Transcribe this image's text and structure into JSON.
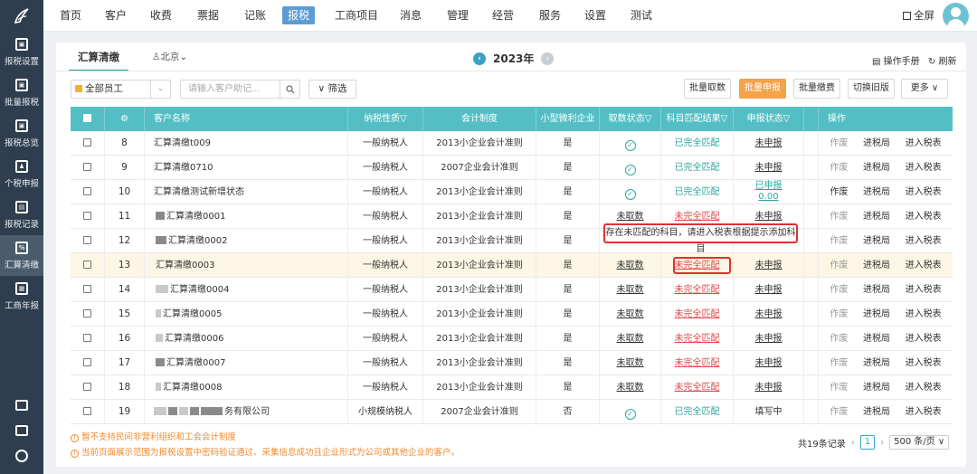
{
  "sidebar": {
    "items": [
      {
        "label": "报税设置",
        "icon": "monitor-gear-icon"
      },
      {
        "label": "批量报税",
        "icon": "monitor-upload-icon"
      },
      {
        "label": "报税总览",
        "icon": "monitor-chart-icon"
      },
      {
        "label": "个税申报",
        "icon": "person-tax-icon"
      },
      {
        "label": "报税记录",
        "icon": "record-icon"
      },
      {
        "label": "汇算清缴",
        "icon": "percent-doc-icon"
      },
      {
        "label": "工商年报",
        "icon": "annual-report-icon"
      }
    ],
    "bottom_icons": [
      "terminal-icon",
      "download-icon",
      "headset-icon"
    ]
  },
  "nav": {
    "items": [
      "首页",
      "客户",
      "收费",
      "票据",
      "记账",
      "报税",
      "工商项目",
      "消息",
      "管理",
      "经营",
      "服务",
      "设置",
      "测试"
    ],
    "active": "报税",
    "fullscreen": "全屏"
  },
  "page": {
    "tab": "汇算清缴",
    "location": "♙北京⌄",
    "year": "2023年",
    "manual": "操作手册",
    "refresh": "刷新"
  },
  "filters": {
    "employee": "全部员工",
    "search_placeholder": "请输入客户助记...",
    "filter_label": "筛选"
  },
  "actions": {
    "batch_fetch": "批量取数",
    "batch_declare": "批量申报",
    "batch_pay": "批量缴费",
    "switch_old": "切换旧版",
    "more": "更多"
  },
  "table": {
    "headers": [
      "客户名称",
      "纳税性质",
      "会计制度",
      "小型微利企业",
      "取数状态",
      "科目匹配结果",
      "申报状态",
      "操作"
    ],
    "rows": [
      {
        "no": "8",
        "name": "汇算清缴t009",
        "nature": "一般纳税人",
        "system": "2013小企业会计准则",
        "small": "是",
        "fetch": "✓",
        "match": "已完全匹配",
        "declare": "未申报",
        "op1": "作废",
        "op2": "进税局",
        "op3": "进入税表"
      },
      {
        "no": "9",
        "name": "汇算清缴0710",
        "nature": "一般纳税人",
        "system": "2007企业会计准则",
        "small": "是",
        "fetch": "✓",
        "match": "已完全匹配",
        "declare": "未申报",
        "op1": "作废",
        "op2": "进税局",
        "op3": "进入税表"
      },
      {
        "no": "10",
        "name": "汇算清缴测试新增状态",
        "nature": "一般纳税人",
        "system": "2013小企业会计准则",
        "small": "是",
        "fetch": "✓",
        "match": "已完全匹配",
        "declare": "已申报",
        "declare2": "0.00",
        "op1": "作废",
        "op2": "进税局",
        "op3": "进入税表"
      },
      {
        "no": "11",
        "name": "汇算清缴0001",
        "nature": "一般纳税人",
        "system": "2013小企业会计准则",
        "small": "是",
        "fetch": "未取数",
        "match": "未完全匹配",
        "declare": "未申报",
        "op1": "作废",
        "op2": "进税局",
        "op3": "进入税表"
      },
      {
        "no": "12",
        "name": "汇算清缴0002",
        "nature": "一般纳税人",
        "system": "2013小企业会计准则",
        "small": "是",
        "fetch": "",
        "match": "",
        "declare": "",
        "op1": "作废",
        "op2": "进税局",
        "op3": "进入税表"
      },
      {
        "no": "13",
        "name": "汇算清缴0003",
        "nature": "一般纳税人",
        "system": "2013小企业会计准则",
        "small": "是",
        "fetch": "未取数",
        "match": "未完全匹配",
        "declare": "未申报",
        "op1": "作废",
        "op2": "进税局",
        "op3": "进入税表"
      },
      {
        "no": "14",
        "name": "汇算清缴0004",
        "nature": "一般纳税人",
        "system": "2013小企业会计准则",
        "small": "是",
        "fetch": "未取数",
        "match": "未完全匹配",
        "declare": "未申报",
        "op1": "作废",
        "op2": "进税局",
        "op3": "进入税表"
      },
      {
        "no": "15",
        "name": "汇算清缴0005",
        "nature": "一般纳税人",
        "system": "2013小企业会计准则",
        "small": "是",
        "fetch": "未取数",
        "match": "未完全匹配",
        "declare": "未申报",
        "op1": "作废",
        "op2": "进税局",
        "op3": "进入税表"
      },
      {
        "no": "16",
        "name": "汇算清缴0006",
        "nature": "一般纳税人",
        "system": "2013小企业会计准则",
        "small": "是",
        "fetch": "未取数",
        "match": "未完全匹配",
        "declare": "未申报",
        "op1": "作废",
        "op2": "进税局",
        "op3": "进入税表"
      },
      {
        "no": "17",
        "name": "汇算清缴0007",
        "nature": "一般纳税人",
        "system": "2013小企业会计准则",
        "small": "是",
        "fetch": "未取数",
        "match": "未完全匹配",
        "declare": "未申报",
        "op1": "作废",
        "op2": "进税局",
        "op3": "进入税表"
      },
      {
        "no": "18",
        "name": "汇算清缴0008",
        "nature": "一般纳税人",
        "system": "2013小企业会计准则",
        "small": "是",
        "fetch": "未取数",
        "match": "未完全匹配",
        "declare": "未申报",
        "op1": "作废",
        "op2": "进税局",
        "op3": "进入税表"
      },
      {
        "no": "19",
        "name": "务有限公司",
        "nature": "小规模纳税人",
        "system": "2007企业会计准则",
        "small": "否",
        "fetch": "✓",
        "match": "已完全匹配",
        "declare": "填写中",
        "op1": "作废",
        "op2": "进税局",
        "op3": "进入税表"
      }
    ]
  },
  "tooltip": "存在未匹配的科目，请进入税表根据提示添加科目",
  "notes": [
    "暂不支持民间非营利组织和工会会计制度",
    "当前页面展示范围为报税设置中密码验证通过、采集信息成功且企业形式为公司或其他企业的客户。"
  ],
  "pager": {
    "total": "共19条记录",
    "page": "1",
    "size": "500 条/页"
  },
  "colors": {
    "sidebar": "#2e3e4e",
    "header": "#53bfc5",
    "primary_button": "#f5a34a",
    "danger": "#e0302f",
    "match": "#27a59b"
  }
}
